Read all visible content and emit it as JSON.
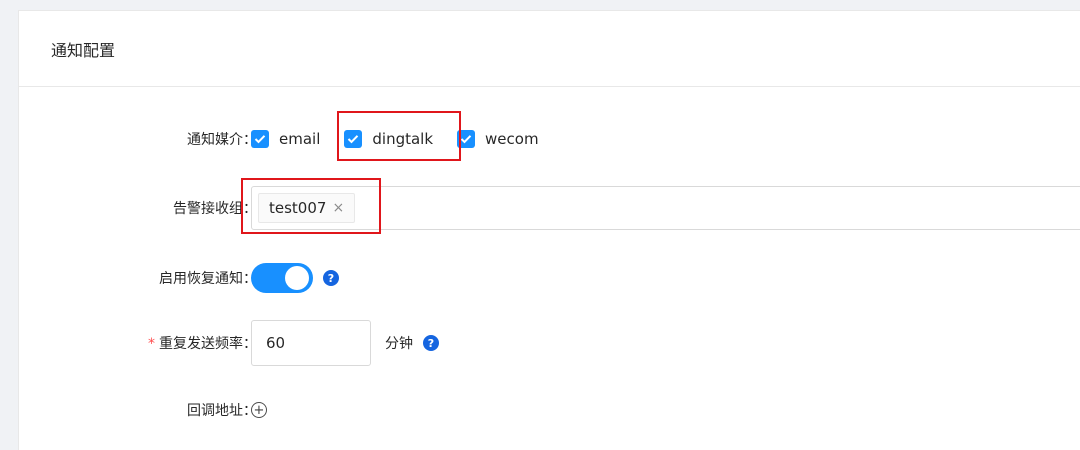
{
  "card": {
    "title": "通知配置"
  },
  "form": {
    "media": {
      "label": "通知媒介：",
      "options": [
        {
          "label": "email",
          "checked": true
        },
        {
          "label": "dingtalk",
          "checked": true
        },
        {
          "label": "wecom",
          "checked": true
        }
      ]
    },
    "groups": {
      "label": "告警接收组：",
      "tags": [
        {
          "label": "test007",
          "close": "×"
        }
      ]
    },
    "recovery": {
      "label": "启用恢复通知：",
      "enabled": true,
      "help": "?"
    },
    "repeat": {
      "required_mark": "*",
      "label": "重复发送频率：",
      "value": "60",
      "unit": "分钟",
      "help": "?"
    },
    "callback": {
      "label": "回调地址：",
      "add": "+"
    }
  },
  "colors": {
    "primary": "#1890ff",
    "highlight": "#e0161b",
    "required": "#ff4d4f"
  }
}
